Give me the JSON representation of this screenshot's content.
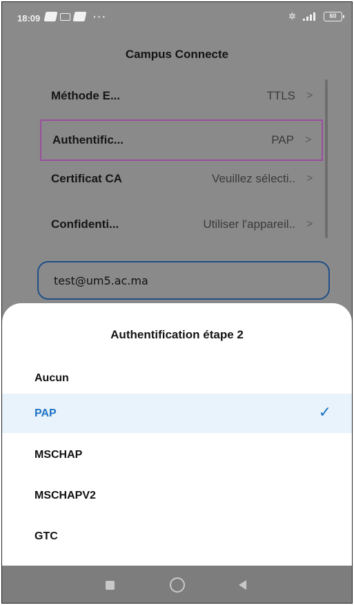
{
  "status_bar": {
    "time": "18:09",
    "dots": "···",
    "battery": "60"
  },
  "screen": {
    "title": "Campus Connecte",
    "rows": [
      {
        "label": "Méthode E...",
        "value": "TTLS"
      },
      {
        "label": "Authentific...",
        "value": "PAP"
      },
      {
        "label": "Certificat CA",
        "value": "Veuillez sélecti.."
      },
      {
        "label": "Confidenti...",
        "value": "Utiliser l'appareil.."
      }
    ],
    "chevron": ">",
    "identity_value": "test@um5.ac.ma"
  },
  "sheet": {
    "title": "Authentification étape 2",
    "options": [
      "Aucun",
      "PAP",
      "MSCHAP",
      "MSCHAPV2",
      "GTC"
    ],
    "selected": "PAP",
    "check": "✓"
  },
  "colors": {
    "accent": "#1e73c4",
    "highlight_border": "#9b4e9f",
    "selected_bg": "#e8f3fb"
  }
}
